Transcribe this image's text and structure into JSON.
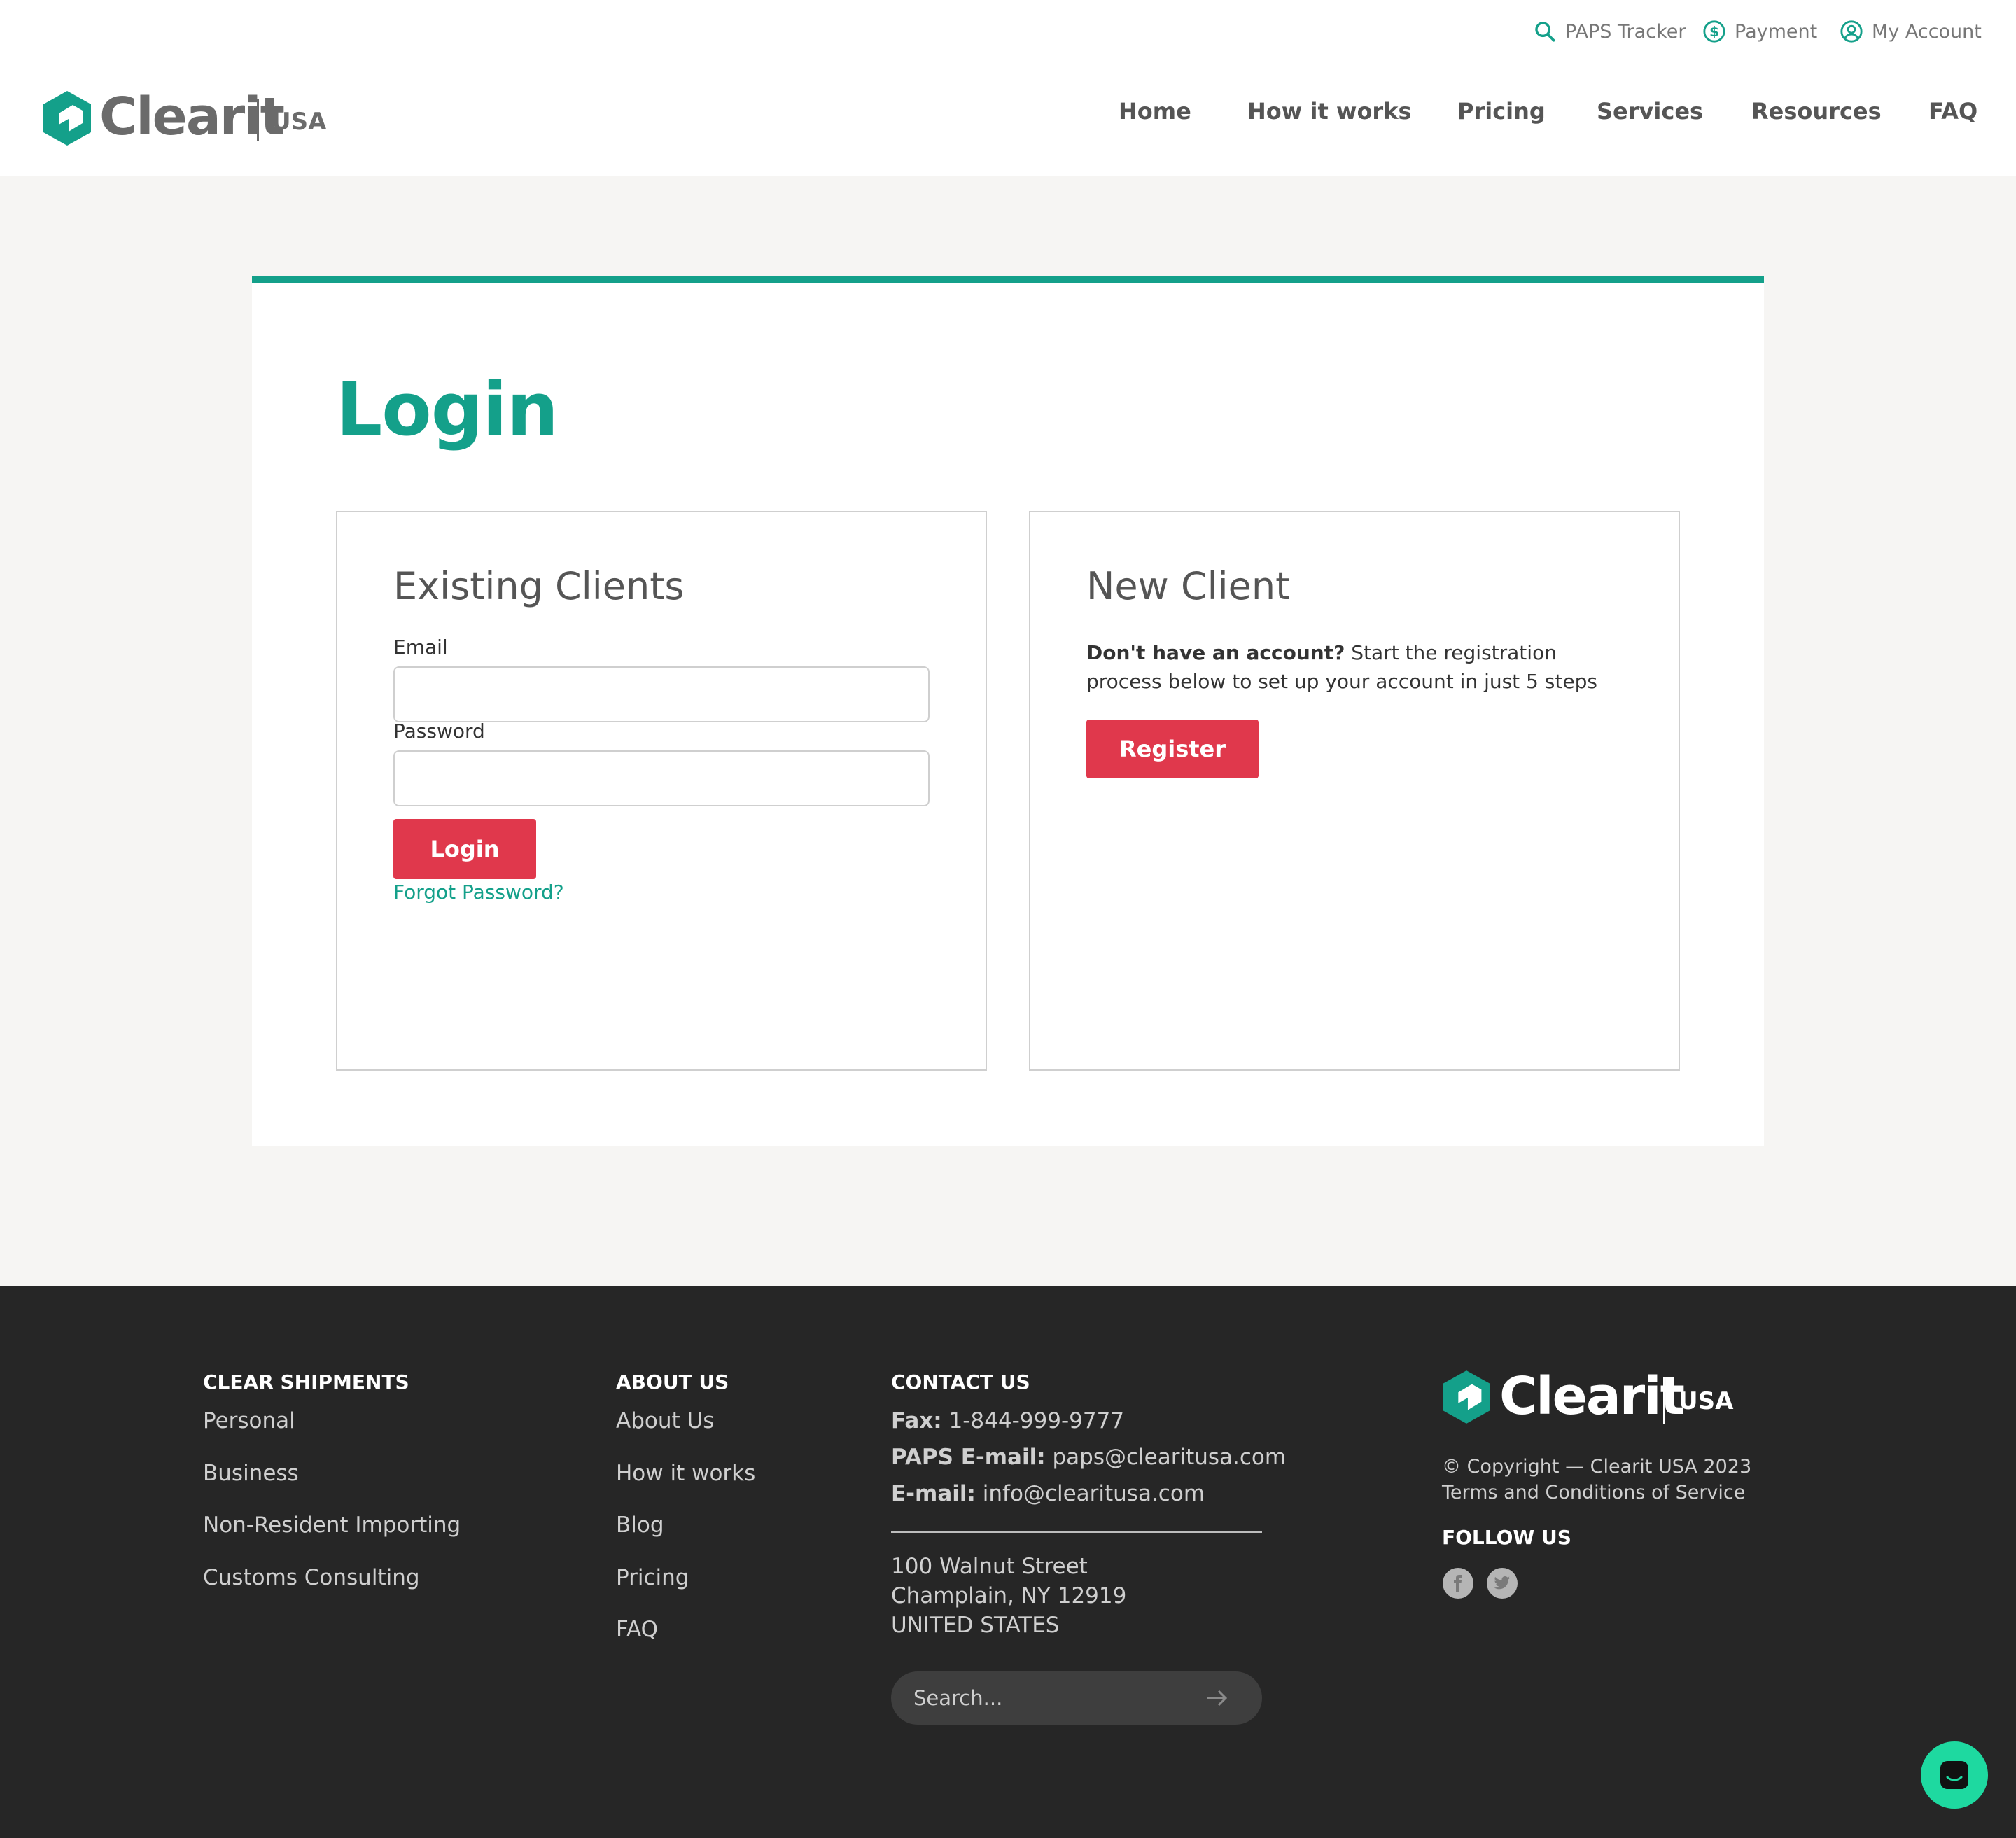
{
  "brand": {
    "name": "Clearit",
    "region": "USA",
    "colors": {
      "teal": "#14a08a",
      "red": "#e0384c",
      "footer_bg": "#262626",
      "chat": "#1ed9a0"
    }
  },
  "utility_nav": [
    {
      "label": "PAPS Tracker",
      "icon": "search-icon"
    },
    {
      "label": "Payment",
      "icon": "dollar-icon"
    },
    {
      "label": "My Account",
      "icon": "user-icon"
    }
  ],
  "main_nav": [
    "Home",
    "How it works",
    "Pricing",
    "Services",
    "Resources",
    "FAQ"
  ],
  "page": {
    "title": "Login"
  },
  "existing_clients": {
    "heading": "Existing Clients",
    "email_label": "Email",
    "email_value": "",
    "password_label": "Password",
    "password_value": "",
    "login_button": "Login",
    "forgot_link": "Forgot Password?"
  },
  "new_client": {
    "heading": "New Client",
    "lead_bold": "Don't have an account?",
    "lead_text": " Start the registration process below to set up your account in just 5 steps",
    "register_button": "Register"
  },
  "footer": {
    "clear_shipments": {
      "heading": "CLEAR SHIPMENTS",
      "links": [
        "Personal",
        "Business",
        "Non-Resident Importing",
        "Customs Consulting"
      ]
    },
    "about_us": {
      "heading": "ABOUT US",
      "links": [
        "About Us",
        "How it works",
        "Blog",
        "Pricing",
        "FAQ"
      ]
    },
    "contact_us": {
      "heading": "CONTACT US",
      "fax_label": "Fax:",
      "fax": " 1-844-999-9777",
      "paps_label": "PAPS E-mail:",
      "paps_email": " paps@clearitusa.com",
      "email_label": "E-mail:",
      "email": " info@clearitusa.com",
      "address": [
        "100 Walnut Street",
        "Champlain, NY 12919",
        "UNITED STATES"
      ],
      "search_placeholder": "Search..."
    },
    "copyright": "© Copyright — Clearit USA 2023",
    "terms": "Terms and Conditions of Service",
    "follow_us": "FOLLOW US",
    "social": [
      "facebook-icon",
      "twitter-icon"
    ]
  }
}
